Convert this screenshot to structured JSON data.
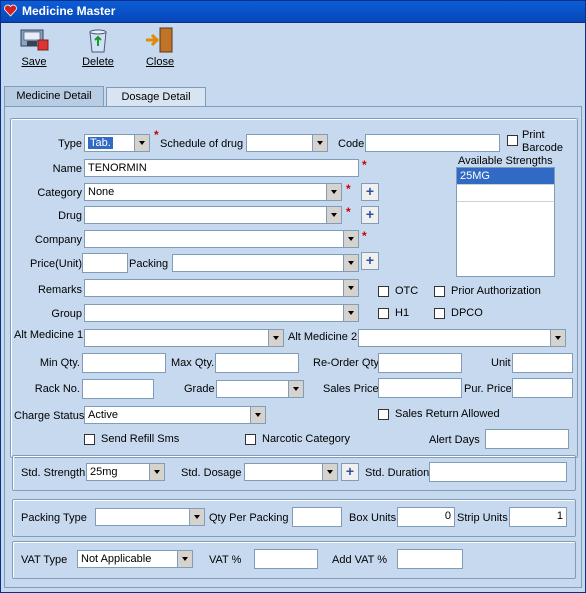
{
  "window": {
    "title": "Medicine Master"
  },
  "toolbar": {
    "save": "Save",
    "delete": "Delete",
    "close": "Close"
  },
  "tabs": [
    {
      "label": "Medicine Detail"
    },
    {
      "label": "Dosage Detail"
    }
  ],
  "form": {
    "type": {
      "label": "Type",
      "value": "Tab."
    },
    "schedule": {
      "label": "Schedule of drug",
      "value": ""
    },
    "code": {
      "label": "Code",
      "value": ""
    },
    "print_barcode": {
      "label_line1": "Print",
      "label_line2": "Barcode"
    },
    "name": {
      "label": "Name",
      "value": "TENORMIN"
    },
    "available_strengths": {
      "label": "Available Strengths",
      "items": [
        "25MG"
      ]
    },
    "category": {
      "label": "Category",
      "value": "None"
    },
    "drug": {
      "label": "Drug",
      "value": ""
    },
    "company": {
      "label": "Company",
      "value": ""
    },
    "price": {
      "label": "Price(Unit)",
      "value": ""
    },
    "packing": {
      "label": "Packing",
      "value": ""
    },
    "remarks": {
      "label": "Remarks",
      "value": ""
    },
    "group": {
      "label": "Group",
      "value": ""
    },
    "otc": {
      "label": "OTC"
    },
    "prior_auth": {
      "label": "Prior Authorization"
    },
    "h1": {
      "label": "H1"
    },
    "dpco": {
      "label": "DPCO"
    },
    "alt_medicine1": {
      "label": "Alt Medicine 1",
      "value": ""
    },
    "alt_medicine2": {
      "label": "Alt Medicine 2",
      "value": ""
    },
    "min_qty": {
      "label": "Min Qty.",
      "value": ""
    },
    "max_qty": {
      "label": "Max Qty.",
      "value": ""
    },
    "reorder_qty": {
      "label": "Re-Order Qty",
      "value": ""
    },
    "unit": {
      "label": "Unit",
      "value": ""
    },
    "rack_no": {
      "label": "Rack No.",
      "value": ""
    },
    "grade": {
      "label": "Grade",
      "value": ""
    },
    "sales_price": {
      "label": "Sales Price",
      "value": ""
    },
    "pur_price": {
      "label": "Pur. Price",
      "value": ""
    },
    "charge_status": {
      "label": "Charge Status",
      "value": "Active"
    },
    "sales_return_allowed": {
      "label": "Sales Return Allowed"
    },
    "send_refill_sms": {
      "label": "Send Refill Sms"
    },
    "narcotic_category": {
      "label": "Narcotic Category"
    },
    "alert_days": {
      "label": "Alert Days",
      "value": ""
    }
  },
  "std": {
    "strength": {
      "label": "Std. Strength",
      "value": "25mg"
    },
    "dosage": {
      "label": "Std. Dosage",
      "value": ""
    },
    "duration": {
      "label": "Std. Duration",
      "value": ""
    }
  },
  "packing_group": {
    "packing_type": {
      "label": "Packing Type",
      "value": ""
    },
    "qty_per_packing": {
      "label": "Qty Per Packing",
      "value": ""
    },
    "box_units": {
      "label": "Box Units",
      "value": "0"
    },
    "strip_units": {
      "label": "Strip Units",
      "value": "1"
    }
  },
  "vat": {
    "vat_type": {
      "label": "VAT Type",
      "value": "Not Applicable"
    },
    "vat_pct": {
      "label": "VAT %",
      "value": ""
    },
    "add_vat_pct": {
      "label": "Add VAT %",
      "value": ""
    }
  },
  "colors": {
    "titlebar": "#0a5fd8",
    "window_bg": "#c7d9ee",
    "required_star": "#cc0000",
    "selected_item": "#316ac5"
  }
}
